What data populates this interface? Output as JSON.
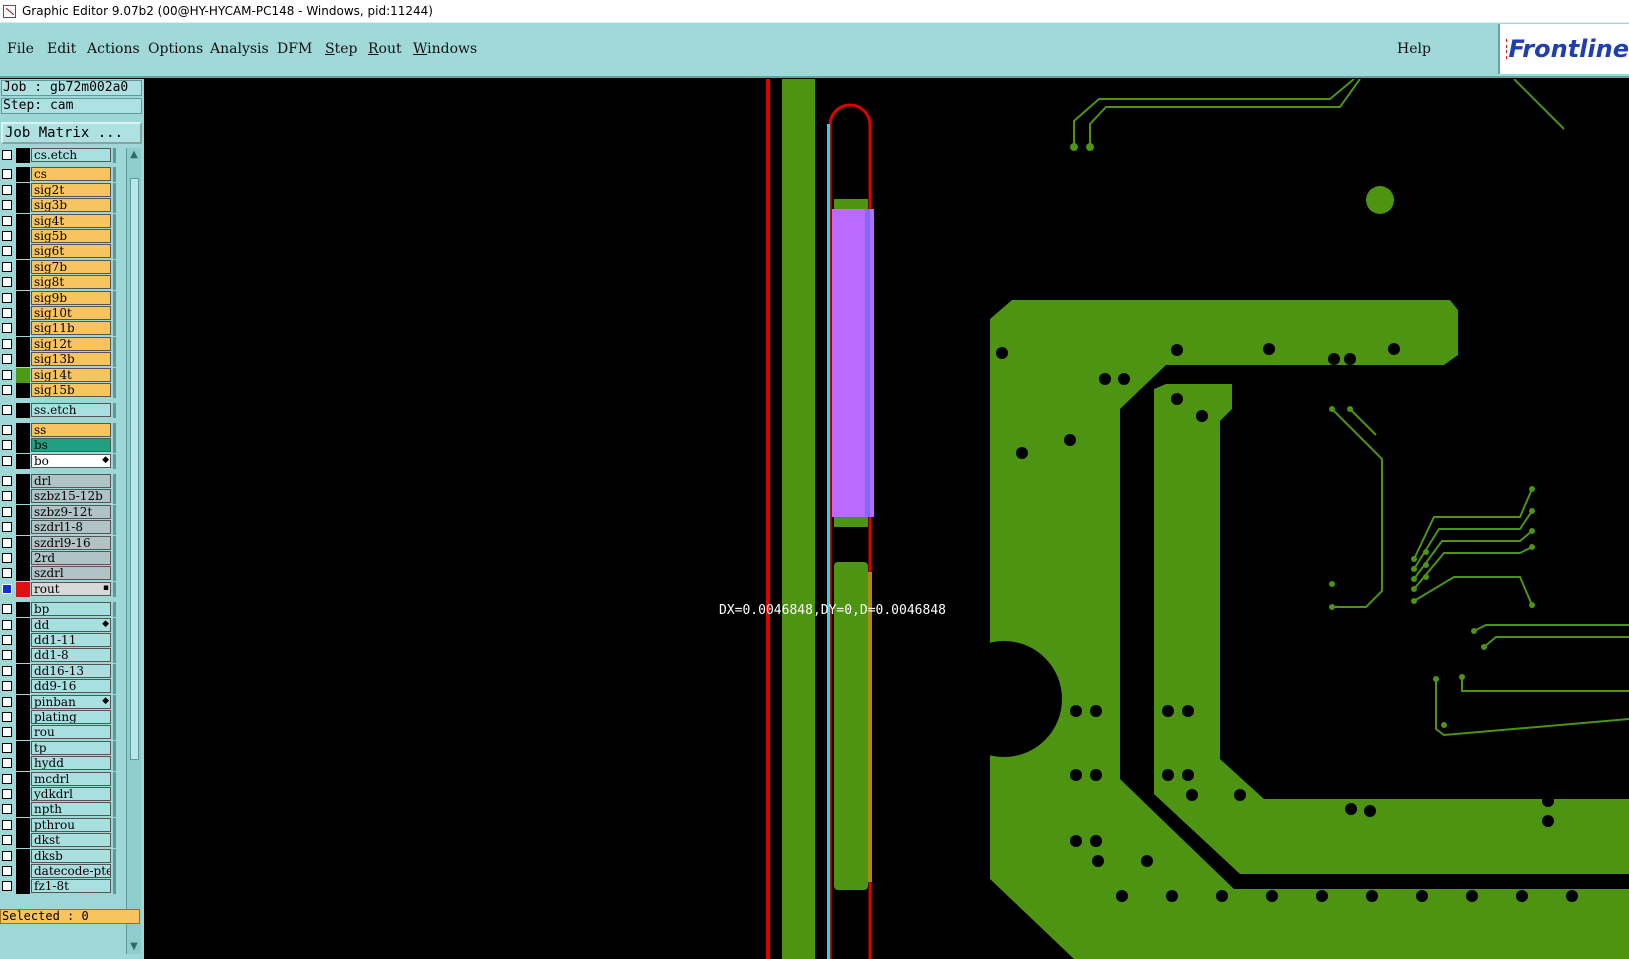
{
  "window": {
    "title": "Graphic Editor 9.07b2 (00@HY-HYCAM-PC148 - Windows, pid:11244)"
  },
  "menu": {
    "items": [
      "File",
      "Edit",
      "Actions",
      "Options",
      "Analysis",
      "DFM",
      "Step",
      "Rout",
      "Windows"
    ],
    "help": "Help"
  },
  "brand": {
    "text": "Frontline"
  },
  "job": {
    "job_label": "Job : gb72m002a0",
    "step_label": "Step: cam",
    "matrix_button": "Job Matrix ..."
  },
  "layers": [
    {
      "name": "cs.etch",
      "color": "#a8e0e0",
      "sw": "#000"
    },
    {
      "name": "cs",
      "color": "#f8c460",
      "sw": "#000"
    },
    {
      "name": "sig2t",
      "color": "#f8c460",
      "sw": "#000"
    },
    {
      "name": "sig3b",
      "color": "#f8c460",
      "sw": "#000"
    },
    {
      "name": "sig4t",
      "color": "#f8c460",
      "sw": "#000"
    },
    {
      "name": "sig5b",
      "color": "#f8c460",
      "sw": "#000"
    },
    {
      "name": "sig6t",
      "color": "#f8c460",
      "sw": "#000"
    },
    {
      "name": "sig7b",
      "color": "#f8c460",
      "sw": "#000"
    },
    {
      "name": "sig8t",
      "color": "#f8c460",
      "sw": "#000"
    },
    {
      "name": "sig9b",
      "color": "#f8c460",
      "sw": "#000"
    },
    {
      "name": "sig10t",
      "color": "#f8c460",
      "sw": "#000"
    },
    {
      "name": "sig11b",
      "color": "#f8c460",
      "sw": "#000"
    },
    {
      "name": "sig12t",
      "color": "#f8c460",
      "sw": "#000"
    },
    {
      "name": "sig13b",
      "color": "#f8c460",
      "sw": "#000"
    },
    {
      "name": "sig14t",
      "color": "#f8c460",
      "sw": "#4d9a18"
    },
    {
      "name": "sig15b",
      "color": "#f8c460",
      "sw": "#000"
    },
    {
      "name": "ss.etch",
      "color": "#a8e0e0",
      "sw": "#000"
    },
    {
      "name": "ss",
      "color": "#f8c460",
      "sw": "#000"
    },
    {
      "name": "bs",
      "color": "#20a080",
      "sw": "#000"
    },
    {
      "name": "bo",
      "color": "#ffffff",
      "sw": "#000",
      "mark": "◆"
    },
    {
      "name": "drl",
      "color": "#b0c4c8",
      "sw": "#000"
    },
    {
      "name": "szbz15-12b",
      "color": "#b0c4c8",
      "sw": "#000"
    },
    {
      "name": "szbz9-12t",
      "color": "#b0c4c8",
      "sw": "#000"
    },
    {
      "name": "szdrl1-8",
      "color": "#b0c4c8",
      "sw": "#000"
    },
    {
      "name": "szdrl9-16",
      "color": "#b0c4c8",
      "sw": "#000"
    },
    {
      "name": "2rd",
      "color": "#b0c4c8",
      "sw": "#000"
    },
    {
      "name": "szdrl",
      "color": "#b0c4c8",
      "sw": "#000"
    },
    {
      "name": "rout",
      "color": "#d8d8d8",
      "sw": "#e01010",
      "checked": true,
      "mark": "▪"
    },
    {
      "name": "bp",
      "color": "#a8e0e0",
      "sw": "#000"
    },
    {
      "name": "dd",
      "color": "#a8e0e0",
      "sw": "#000",
      "mark": "◆"
    },
    {
      "name": "dd1-11",
      "color": "#a8e0e0",
      "sw": "#000"
    },
    {
      "name": "dd1-8",
      "color": "#a8e0e0",
      "sw": "#000"
    },
    {
      "name": "dd16-13",
      "color": "#a8e0e0",
      "sw": "#000"
    },
    {
      "name": "dd9-16",
      "color": "#a8e0e0",
      "sw": "#000"
    },
    {
      "name": "pinban",
      "color": "#a8e0e0",
      "sw": "#000",
      "mark": "◆"
    },
    {
      "name": "plating",
      "color": "#a8e0e0",
      "sw": "#000"
    },
    {
      "name": "rou",
      "color": "#a8e0e0",
      "sw": "#000"
    },
    {
      "name": "tp",
      "color": "#a8e0e0",
      "sw": "#000"
    },
    {
      "name": "hydd",
      "color": "#a8e0e0",
      "sw": "#000"
    },
    {
      "name": "mcdrl",
      "color": "#a8e0e0",
      "sw": "#000"
    },
    {
      "name": "ydkdrl",
      "color": "#a8e0e0",
      "sw": "#000"
    },
    {
      "name": "npth",
      "color": "#a8e0e0",
      "sw": "#000"
    },
    {
      "name": "pthrou",
      "color": "#a8e0e0",
      "sw": "#000"
    },
    {
      "name": "dkst",
      "color": "#a8e0e0",
      "sw": "#000"
    },
    {
      "name": "dksb",
      "color": "#a8e0e0",
      "sw": "#000"
    },
    {
      "name": "datecode-pte",
      "color": "#a8e0e0",
      "sw": "#000"
    },
    {
      "name": "fz1-8t",
      "color": "#a8e0e0",
      "sw": "#000"
    }
  ],
  "status": {
    "selected": "Selected : 0"
  },
  "measurement": {
    "text": "DX=0.0046848,DY=0,D=0.0046848"
  },
  "colors": {
    "board_green": "#4c9412",
    "rout_red": "#e00000",
    "cyan": "#22d8e8",
    "violet": "#b96bff",
    "panel": "#a1d9d9"
  }
}
